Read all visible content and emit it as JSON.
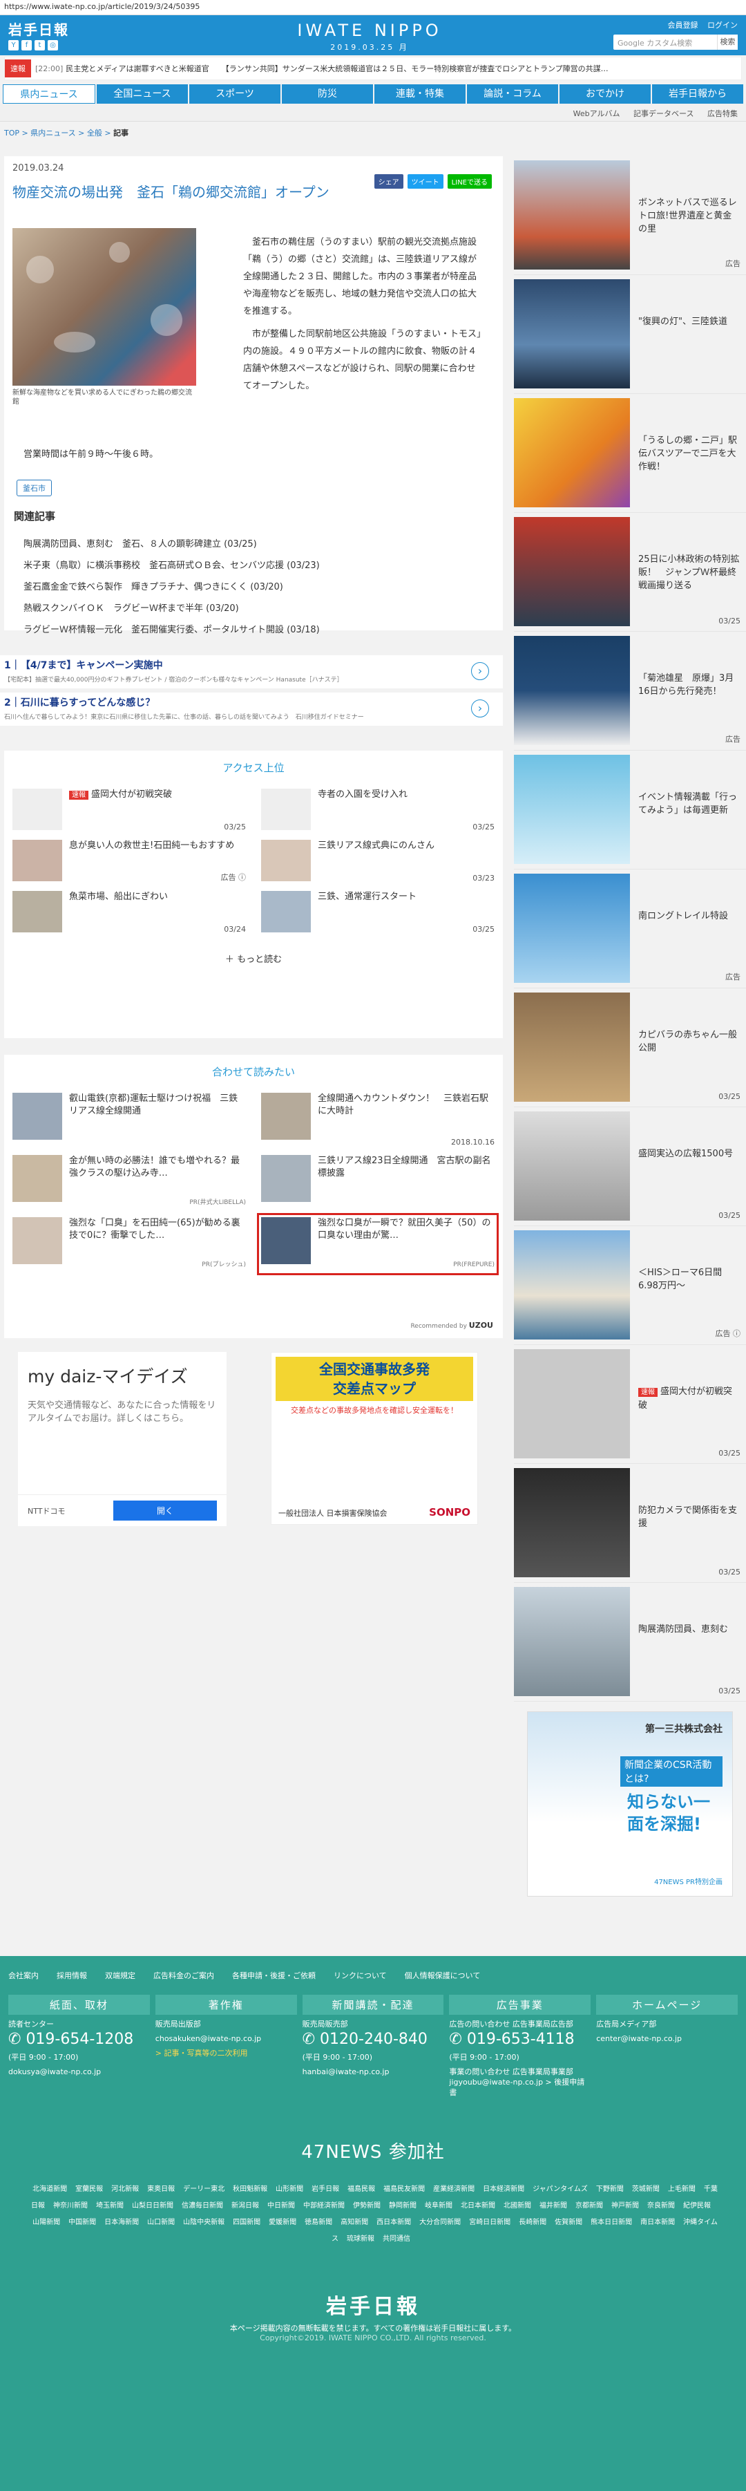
{
  "url": "https://www.iwate-np.co.jp/article/2019/3/24/50395",
  "header": {
    "logo": "岩手日報",
    "site_name": "IWATE NIPPO",
    "date": "2019.03.25 月",
    "link_register": "会員登録",
    "link_login": "ログイン",
    "search_placeholder": "Google カスタム検索",
    "search_btn": "検索",
    "social": [
      "Y",
      "f",
      "t",
      "◎"
    ]
  },
  "ticker": {
    "label": "速報",
    "items": [
      {
        "time": "[22:00]",
        "text": "民主党とメディアは謝罪すべきと米報道官"
      },
      {
        "time": "",
        "text": "【ランサン共同】サンダース米大統領報道官は２５日、モラー特別検察官が捜査でロシアとトランプ陣営の共謀…"
      }
    ]
  },
  "nav": [
    "県内ニュース",
    "全国ニュース",
    "スポーツ",
    "防災",
    "連載・特集",
    "論説・コラム",
    "おでかけ",
    "岩手日報から"
  ],
  "subnav": [
    "Webアルバム",
    "記事データベース",
    "広告特集"
  ],
  "breadcrumb": [
    "TOP",
    "県内ニュース",
    "全般",
    "記事"
  ],
  "article": {
    "date": "2019.03.24",
    "share": [
      "シェア",
      "ツイート",
      "LINEで送る"
    ],
    "title": "物産交流の場出発　釜石「鵜の郷交流館」オープン",
    "caption": "新鮮な海産物などを買い求める人でにぎわった鵜の郷交流館",
    "paragraphs": [
      "釜石市の鵜住居（うのすまい）駅前の観光交流拠点施設「鵜（う）の郷（さと）交流館」は、三陸鉄道リアス線が全線開通した２３日、開館した。市内の３事業者が特産品や海産物などを販売し、地域の魅力発信や交流人口の拡大を推進する。",
      "市が整備した同駅前地区公共施設「うのすまい・トモス」内の施設。４９０平方メートルの館内に飲食、物販の計４店舗や休憩スペースなどが設けられ、同駅の開業に合わせてオープンした。"
    ],
    "hours": "営業時間は午前９時〜午後６時。",
    "tag": "釜石市",
    "related_heading": "関連記事",
    "related": [
      "陶展満防団員、恵刻む　釜石、８人の顕彰碑建立 (03/25)",
      "米子東（鳥取）に横浜事務校　釜石高研式ＯＢ会、センバツ応援 (03/23)",
      "釜石鷹金金で鉄べら製作　輝きプラチナ、偶つきにくく (03/20)",
      "熱戦スクンバイＯＫ　ラグビーＷ杯まで半年 (03/20)",
      "ラグビーＷ杯情報一元化　釜石開催実行委、ポータルサイト開設 (03/18)"
    ]
  },
  "adlinks": [
    {
      "num": "1",
      "title": "【4/7まで】キャンペーン実施中",
      "sub": "【宅配本】抽選で最大40,000円分のギフト券プレゼント / 宿泊のクーポンも様々なキャンペーン Hanasute［ハナステ］"
    },
    {
      "num": "2",
      "title": "石川に暮らすってどんな感じ？",
      "sub": "石川へ住んで暮らしてみよう！東京に石川県に移住した先輩に、仕事の話、暮らしの話を聞いてみよう　石川移住ガイドセミナー"
    }
  ],
  "access": {
    "heading": "アクセス上位",
    "items": [
      {
        "title": "盛岡大付が初戦突破",
        "date": "03/25",
        "badge": "速報"
      },
      {
        "title": "寺者の入園を受け入れ",
        "date": "03/25"
      },
      {
        "title": "息が臭い人の救世主!石田純一もおすすめ",
        "date": "広告 ⓘ"
      },
      {
        "title": "三鉄リアス線式典にのんさん",
        "date": "03/23"
      },
      {
        "title": "魚菜市場、船出にぎわい",
        "date": "03/24"
      },
      {
        "title": "三鉄、通常運行スタート",
        "date": "03/25"
      }
    ],
    "more": "もっと読む"
  },
  "readmore": {
    "heading": "合わせて読みたい",
    "items": [
      {
        "title": "叡山電鉄(京都)運転士駆けつけ祝福　三鉄リアス線全線開通",
        "date": ""
      },
      {
        "title": "全線開通へカウントダウン！　三鉄岩石駅に大時計",
        "date": "2018.10.16"
      },
      {
        "title": "金が無い時の必勝法！誰でも増やれる？最強クラスの駆け込み寺…",
        "pr": "PR(井式大LIBELLA)"
      },
      {
        "title": "三鉄リアス線23日全線開通　宮古駅の副名標披露",
        "date": ""
      },
      {
        "title": "強烈な「口臭」を石田純一(65)が勧める裏技で0に？衝撃でした…",
        "pr": "PR(プレッシュ)"
      },
      {
        "title": "強烈な口臭が一瞬で？就田久美子（50）の口臭ない理由が驚…",
        "pr": "PR(FREPURE)"
      }
    ],
    "recommended": "Recommended by",
    "uzou": "UZOU"
  },
  "ad_daiz": {
    "title": "my daiz-マイデイズ",
    "desc": "天気や交通情報など、あなたに合った情報をリアルタイムでお届け。詳しくはこちら。",
    "company": "NTTドコモ",
    "button": "開く"
  },
  "ad_kotsu": {
    "line1": "全国交通事故多発",
    "line2": "交差点マップ",
    "desc": "交差点などの事故多発地点を確認し安全運転を！",
    "org": "一般社団法人 日本損害保険協会",
    "brand": "SONPO"
  },
  "sidebar": [
    {
      "title": "ボンネットバスで巡るレトロ旅!世界遺産と黄金の里",
      "date": "広告"
    },
    {
      "title": "\"復興の灯\"、三陸鉄道",
      "date": ""
    },
    {
      "title": "「うるしの郷・二戸」駅伝バスツアーで二戸を大作戦！",
      "date": ""
    },
    {
      "title": "25日に小林政術の特別拡販！　ジャンプＷ杯最終戦画撮り送る",
      "date": "03/25"
    },
    {
      "title": "「菊池雄星　原爆」3月16日から先行発売！",
      "date": "広告"
    },
    {
      "title": "イベント情報満載「行ってみよう」は毎週更新",
      "date": ""
    },
    {
      "title": "南ロングトレイル特設",
      "date": "広告"
    },
    {
      "title": "カピバラの赤ちゃん一般公開",
      "date": "03/25"
    },
    {
      "title": "盛岡実込の広報1500号",
      "date": "03/25"
    },
    {
      "title": "＜HIS＞ローマ6日間 6.98万円〜",
      "date": "広告 ⓘ"
    },
    {
      "title": "盛岡大付が初戦突破",
      "date": "03/25",
      "badge": "速報"
    },
    {
      "title": "防犯カメラで関係街を支援",
      "date": "03/25"
    },
    {
      "title": "陶展満防団員、恵刻む",
      "date": "03/25"
    }
  ],
  "sidebar_ad": {
    "company": "第一三共株式会社",
    "line1": "新聞企業のCSR活動とは?",
    "line2": "知らない一面を深掘!",
    "note": "47NEWS PR特別企画"
  },
  "footer": {
    "links": [
      "会社案内",
      "採用情報",
      "双端規定",
      "広告料金のご案内",
      "各種申請・後援・ご依頼",
      "リンクについて",
      "個人情報保護について"
    ],
    "cols": [
      {
        "head": "紙面、取材",
        "label": "読者センター",
        "phone": "019-654-1208",
        "hours": "(平日 9:00 - 17:00)",
        "email": "dokusya@iwate-np.co.jp"
      },
      {
        "head": "著作権",
        "label": "販売局出版部",
        "phone": "",
        "hours": "chosakuken@iwate-np.co.jp",
        "email": "> 記事・写真等の二次利用"
      },
      {
        "head": "新聞講読・配達",
        "label": "販売局販売部",
        "phone": "0120-240-840",
        "hours": "(平日 9:00 - 17:00)",
        "email": "hanbai@iwate-np.co.jp"
      },
      {
        "head": "広告事業",
        "label": "広告の問い合わせ 広告事業局広告部",
        "phone": "019-653-4118",
        "hours": "(平日 9:00 - 17:00)",
        "email": "事業の問い合わせ 広告事業局事業部 jigyoubu@iwate-np.co.jp > 後援申請書"
      },
      {
        "head": "ホームページ",
        "label": "広告局メディア部",
        "phone": "",
        "hours": "center@iwate-np.co.jp",
        "email": ""
      }
    ],
    "n47": "47NEWS 参加社",
    "papers": [
      "北海道新聞",
      "室蘭民報",
      "河北新報",
      "東奥日報",
      "デーリー東北",
      "秋田魁新報",
      "山形新聞",
      "岩手日報",
      "福島民報",
      "福島民友新聞",
      "産業経済新聞",
      "日本経済新聞",
      "ジャパンタイムズ",
      "下野新聞",
      "茨城新聞",
      "上毛新聞",
      "千葉日報",
      "神奈川新聞",
      "埼玉新聞",
      "山梨日日新聞",
      "信濃毎日新聞",
      "新潟日報",
      "中日新聞",
      "中部経済新聞",
      "伊勢新聞",
      "静岡新聞",
      "岐阜新聞",
      "北日本新聞",
      "北國新聞",
      "福井新聞",
      "京都新聞",
      "神戸新聞",
      "奈良新聞",
      "紀伊民報",
      "山陽新聞",
      "中国新聞",
      "日本海新聞",
      "山口新聞",
      "山陰中央新報",
      "四国新聞",
      "愛媛新聞",
      "徳島新聞",
      "高知新聞",
      "西日本新聞",
      "大分合同新聞",
      "宮崎日日新聞",
      "長崎新聞",
      "佐賀新聞",
      "熊本日日新聞",
      "南日本新聞",
      "沖縄タイムス",
      "琉球新報",
      "共同通信"
    ],
    "logo": "岩手日報",
    "note": "本ページ掲載内容の無断転載を禁じます。すべての著作権は岩手日報社に属します。",
    "copy": "Copyright©2019. IWATE NIPPO CO.,LTD. All rights reserved."
  }
}
